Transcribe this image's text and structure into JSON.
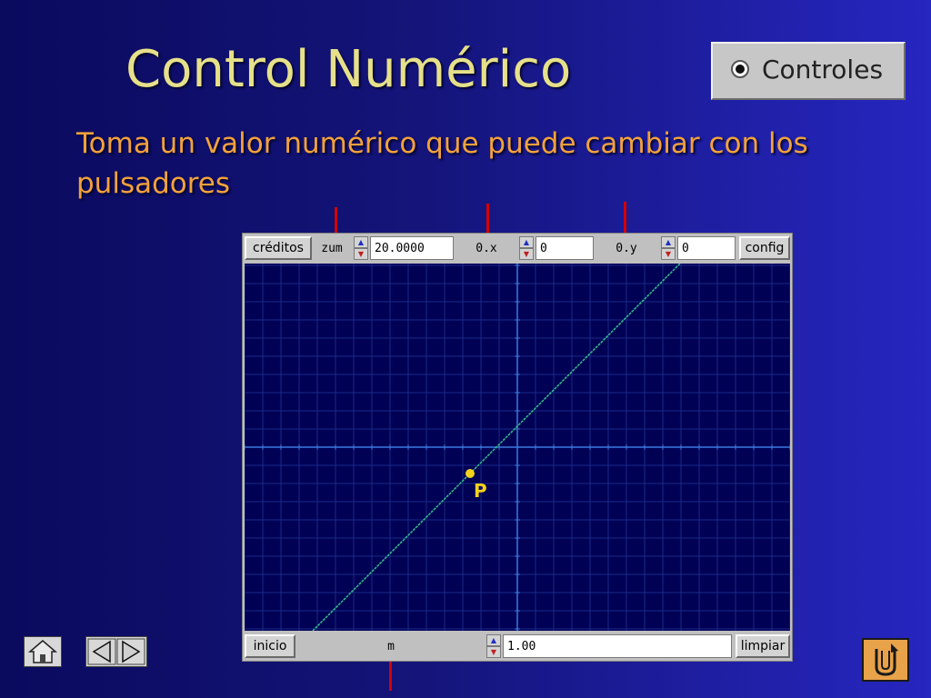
{
  "slide": {
    "title": "Control Numérico",
    "subtitle": "Toma un valor numérico que puede cambiar con los pulsadores"
  },
  "radio": {
    "label": "Controles",
    "selected": true
  },
  "applet": {
    "top_bar": {
      "credits_label": "créditos",
      "zoom_label": "zum",
      "zoom_value": "20.0000",
      "ox_label": "0.x",
      "ox_value": "0",
      "oy_label": "0.y",
      "oy_value": "0",
      "config_label": "config"
    },
    "bottom_bar": {
      "start_label": "inicio",
      "m_label": "m",
      "m_value": "1.00",
      "clear_label": "limpiar"
    },
    "graph": {
      "point_label": "P",
      "point": {
        "x": -2.6,
        "y": -1.45
      },
      "line": {
        "slope": 1.0,
        "intercept": 1.15
      },
      "xlim": [
        -15.0,
        15.0
      ],
      "ylim": [
        -10.1,
        10.1
      ],
      "grid_step": 1,
      "colors": {
        "background": "#000055",
        "grid": "#1a2a88",
        "axes": "#3a7be0",
        "line": "#37c08a",
        "point": "#f2d21b"
      }
    }
  },
  "nav": {
    "home_icon": "home-icon",
    "prev_icon": "previous-arrow-icon",
    "next_icon": "next-arrow-icon",
    "return_icon": "return-icon"
  }
}
